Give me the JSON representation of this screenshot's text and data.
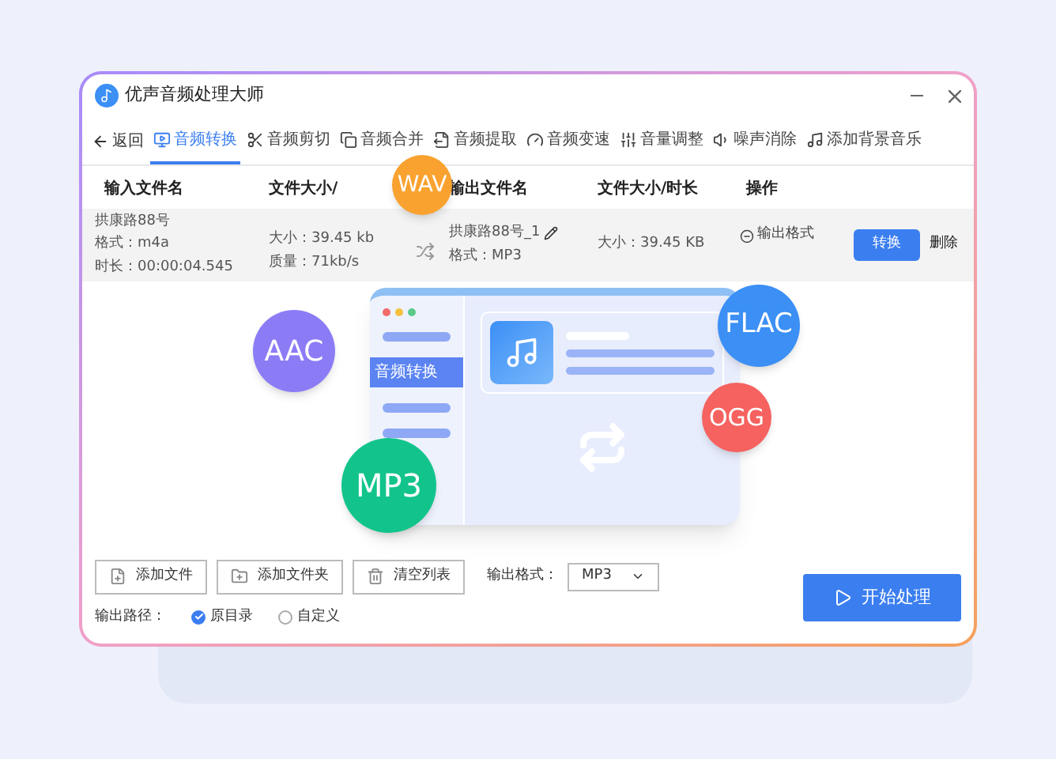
{
  "window": {
    "title": "优声音频处理大师"
  },
  "back_button": {
    "label": "返回"
  },
  "tabs": [
    {
      "label": "音频转换",
      "selected": true
    },
    {
      "label": "音频剪切",
      "selected": false
    },
    {
      "label": "音频合并",
      "selected": false
    },
    {
      "label": "音频提取",
      "selected": false
    },
    {
      "label": "音频变速",
      "selected": false
    },
    {
      "label": "音量调整",
      "selected": false
    },
    {
      "label": "噪声消除",
      "selected": false
    },
    {
      "label": "添加背景音乐",
      "selected": false
    }
  ],
  "table": {
    "columns": [
      "输入文件名",
      "文件大小/",
      "输出文件名",
      "文件大小/时长",
      "操作"
    ],
    "rows": [
      {
        "input_name": "拱康路88号",
        "input_format": "格式：m4a",
        "input_duration": "时长：00:00:04.545",
        "input_size": "大小：39.45 kb",
        "input_quality": "质量：71kb/s",
        "output_name": "拱康路88号_1",
        "output_format": "格式：MP3",
        "output_size": "大小：39.45 KB",
        "format_link": "输出格式",
        "convert_button": "转换",
        "delete_link": "删除"
      }
    ]
  },
  "bottom": {
    "buttons": [
      "添加文件",
      "添加文件夹",
      "清空列表"
    ],
    "format_label": "输出格式：",
    "format_value": "MP3",
    "path_label": "输出路径：",
    "path_options": [
      {
        "label": "原目录",
        "selected": true
      },
      {
        "label": "自定义",
        "selected": false
      }
    ],
    "start_button": "开始处理"
  },
  "illustration": {
    "sidebar_label": "音频转换",
    "badges": [
      {
        "label": "WAV",
        "color": "#f9a22f"
      },
      {
        "label": "AAC",
        "color": "#8b7cf6"
      },
      {
        "label": "MP3",
        "color": "#12c48b"
      },
      {
        "label": "FLAC",
        "color": "#3b8ff5"
      },
      {
        "label": "OGG",
        "color": "#f5625f"
      }
    ]
  }
}
